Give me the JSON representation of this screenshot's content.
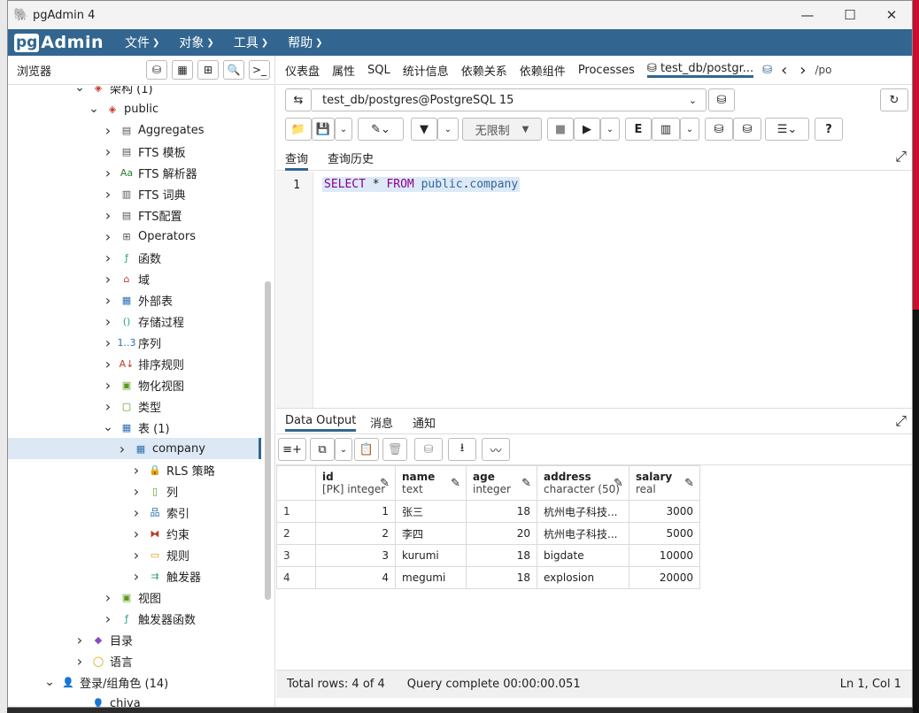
{
  "window": {
    "title": "pgAdmin 4",
    "minimize": "—",
    "maximize": "☐",
    "close": "✕"
  },
  "menubar": {
    "logo_pg": "pg",
    "logo_admin": "Admin",
    "items": [
      {
        "label": "文件"
      },
      {
        "label": "对象"
      },
      {
        "label": "工具"
      },
      {
        "label": "帮助"
      }
    ]
  },
  "browser": {
    "title": "浏览器",
    "tree": [
      {
        "label": "架构 (1)",
        "level": 0,
        "expanded": true,
        "icon": "schema-icon"
      },
      {
        "label": "public",
        "level": 1,
        "expanded": true,
        "icon": "schema-public-icon"
      },
      {
        "label": "Aggregates",
        "level": 2,
        "expanded": false,
        "icon": "aggregate-icon"
      },
      {
        "label": "FTS 模板",
        "level": 2,
        "expanded": false,
        "icon": "fts-template-icon"
      },
      {
        "label": "FTS 解析器",
        "level": 2,
        "expanded": false,
        "icon": "fts-parser-icon"
      },
      {
        "label": "FTS 词典",
        "level": 2,
        "expanded": false,
        "icon": "fts-dictionary-icon"
      },
      {
        "label": "FTS配置",
        "level": 2,
        "expanded": false,
        "icon": "fts-config-icon"
      },
      {
        "label": "Operators",
        "level": 2,
        "expanded": false,
        "icon": "operator-icon"
      },
      {
        "label": "函数",
        "level": 2,
        "expanded": false,
        "icon": "function-icon"
      },
      {
        "label": "域",
        "level": 2,
        "expanded": false,
        "icon": "domain-icon"
      },
      {
        "label": "外部表",
        "level": 2,
        "expanded": false,
        "icon": "foreign-table-icon"
      },
      {
        "label": "存储过程",
        "level": 2,
        "expanded": false,
        "icon": "procedure-icon"
      },
      {
        "label": "序列",
        "level": 2,
        "expanded": false,
        "icon": "sequence-icon"
      },
      {
        "label": "排序规则",
        "level": 2,
        "expanded": false,
        "icon": "collation-icon"
      },
      {
        "label": "物化视图",
        "level": 2,
        "expanded": false,
        "icon": "materialized-view-icon"
      },
      {
        "label": "类型",
        "level": 2,
        "expanded": false,
        "icon": "type-icon"
      },
      {
        "label": "表 (1)",
        "level": 2,
        "expanded": true,
        "icon": "table-icon"
      },
      {
        "label": "company",
        "level": 3,
        "expanded": false,
        "icon": "table-icon",
        "selected": true
      },
      {
        "label": "RLS 策略",
        "level": 4,
        "expanded": false,
        "icon": "rls-policy-icon"
      },
      {
        "label": "列",
        "level": 4,
        "expanded": false,
        "icon": "column-icon"
      },
      {
        "label": "索引",
        "level": 4,
        "expanded": false,
        "icon": "index-icon"
      },
      {
        "label": "约束",
        "level": 4,
        "expanded": false,
        "icon": "constraint-icon"
      },
      {
        "label": "规则",
        "level": 4,
        "expanded": false,
        "icon": "rule-icon"
      },
      {
        "label": "触发器",
        "level": 4,
        "expanded": false,
        "icon": "trigger-icon"
      },
      {
        "label": "视图",
        "level": 2,
        "expanded": false,
        "icon": "view-icon"
      },
      {
        "label": "触发器函数",
        "level": 2,
        "expanded": false,
        "icon": "trigger-function-icon"
      },
      {
        "label": "目录",
        "level": 0,
        "expanded": false,
        "icon": "catalog-icon"
      },
      {
        "label": "语言",
        "level": 0,
        "expanded": false,
        "icon": "language-icon"
      },
      {
        "label": "登录/组角色 (14)",
        "level": -1,
        "expanded": true,
        "icon": "login-role-icon"
      },
      {
        "label": "chiya",
        "level": 0,
        "expanded": false,
        "icon": "user-icon",
        "leaf": true
      }
    ]
  },
  "main_tabs": [
    {
      "label": "仪表盘"
    },
    {
      "label": "属性"
    },
    {
      "label": "SQL"
    },
    {
      "label": "统计信息"
    },
    {
      "label": "依赖关系"
    },
    {
      "label": "依赖组件"
    },
    {
      "label": "Processes"
    },
    {
      "label": "test_db/postgr..."
    }
  ],
  "overflow_tab": "/pos",
  "connection": {
    "label": "test_db/postgres@PostgreSQL 15"
  },
  "query_toolbar": {
    "limit_label": "无限制"
  },
  "query_tabs": [
    {
      "label": "查询"
    },
    {
      "label": "查询历史"
    }
  ],
  "editor": {
    "line_number": "1",
    "tokens": [
      {
        "text": "SELECT",
        "kind": "kw"
      },
      {
        "text": " * ",
        "kind": "plain"
      },
      {
        "text": "FROM",
        "kind": "kw"
      },
      {
        "text": " public",
        "kind": "ident"
      },
      {
        "text": ".",
        "kind": "plain"
      },
      {
        "text": "company",
        "kind": "ident"
      }
    ]
  },
  "output_tabs": [
    {
      "label": "Data Output"
    },
    {
      "label": "消息"
    },
    {
      "label": "通知"
    }
  ],
  "grid": {
    "columns": [
      {
        "name": "id",
        "type": "[PK] integer"
      },
      {
        "name": "name",
        "type": "text"
      },
      {
        "name": "age",
        "type": "integer"
      },
      {
        "name": "address",
        "type": "character (50)"
      },
      {
        "name": "salary",
        "type": "real"
      }
    ],
    "rows": [
      {
        "rownum": "1",
        "cells": [
          "1",
          "张三",
          "18",
          "杭州电子科技...",
          "3000"
        ]
      },
      {
        "rownum": "2",
        "cells": [
          "2",
          "李四",
          "20",
          "杭州电子科技...",
          "5000"
        ]
      },
      {
        "rownum": "3",
        "cells": [
          "3",
          "kurumi",
          "18",
          "bigdate",
          "10000"
        ]
      },
      {
        "rownum": "4",
        "cells": [
          "4",
          "megumi",
          "18",
          "explosion",
          "20000"
        ]
      }
    ]
  },
  "status": {
    "total_rows": "Total rows: 4 of 4",
    "query_complete": "Query complete 00:00:00.051",
    "cursor": "Ln 1, Col 1"
  },
  "colors": {
    "brand": "#326690",
    "selection": "#dce8f4",
    "keyword": "#8b008b",
    "identifier": "#336699"
  }
}
